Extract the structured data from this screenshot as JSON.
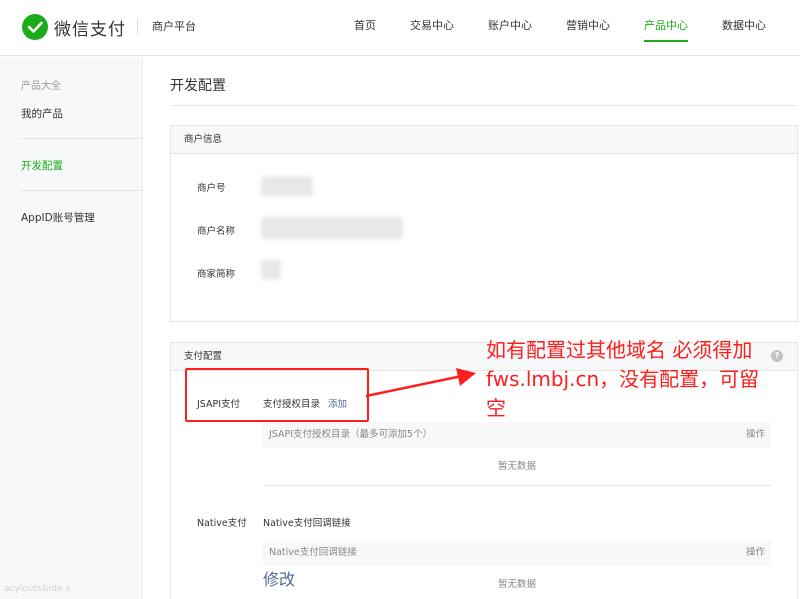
{
  "header": {
    "brand": "微信支付",
    "platform": "商户平台",
    "nav": [
      {
        "label": "首页",
        "active": false
      },
      {
        "label": "交易中心",
        "active": false
      },
      {
        "label": "账户中心",
        "active": false
      },
      {
        "label": "营销中心",
        "active": false
      },
      {
        "label": "产品中心",
        "active": true
      },
      {
        "label": "数据中心",
        "active": false
      }
    ]
  },
  "sidebar": {
    "section_title": "产品大全",
    "items": [
      {
        "label": "我的产品",
        "active": false
      },
      {
        "label": "开发配置",
        "active": true
      },
      {
        "label": "AppID账号管理",
        "active": false
      }
    ]
  },
  "main": {
    "title": "开发配置",
    "merchant_info": {
      "header": "商户信息",
      "fields": [
        {
          "label": "商户号"
        },
        {
          "label": "商户名称"
        },
        {
          "label": "商家简称"
        }
      ]
    },
    "payment_config": {
      "header": "支付配置",
      "help_icon": "?",
      "jsapi": {
        "label": "JSAPI支付",
        "dir_label": "支付授权目录",
        "add_link": "添加",
        "table_header": "JSAPI支付授权目录（最多可添加5个）",
        "action_header": "操作",
        "empty_text": "暂无数据"
      },
      "native": {
        "label": "Native支付",
        "link_label": "Native支付回调链接",
        "table_header": "Native支付回调链接",
        "action_header": "操作",
        "empty_text": "暂无数据",
        "modify_link": "修改"
      }
    }
  },
  "annotation": {
    "text": "如有配置过其他域名 必须得加fws.lmbj.cn，没有配置，可留空",
    "color": "#ff1e1e"
  },
  "watermark": "acylouts&ide s",
  "colors": {
    "brand_green": "#1aad19",
    "link_blue": "#576b95",
    "annotation_red": "#ff1e1e"
  }
}
